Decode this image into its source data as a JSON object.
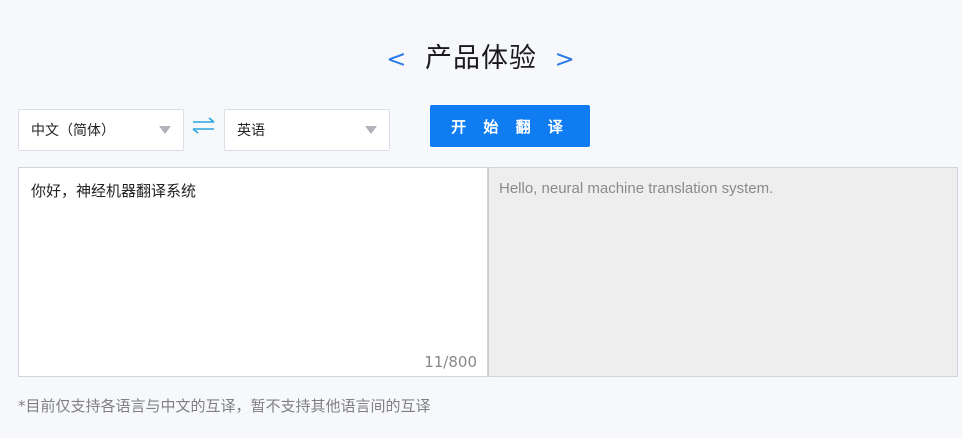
{
  "header": {
    "title": "产品体验",
    "left_chevron": "<",
    "right_chevron": ">"
  },
  "toolbar": {
    "source_language": "中文（简体）",
    "target_language": "英语",
    "translate_label": "开 始 翻 译"
  },
  "input": {
    "text": "你好，神经机器翻译系统",
    "counter": "11/800"
  },
  "output": {
    "text": "Hello, neural machine translation system."
  },
  "footer": {
    "note": "*目前仅支持各语言与中文的互译，暂不支持其他语言间的互译"
  },
  "colors": {
    "accent": "#0f7cf2",
    "chevron": "#2b79e6",
    "swap_icon": "#2aa6e0"
  }
}
